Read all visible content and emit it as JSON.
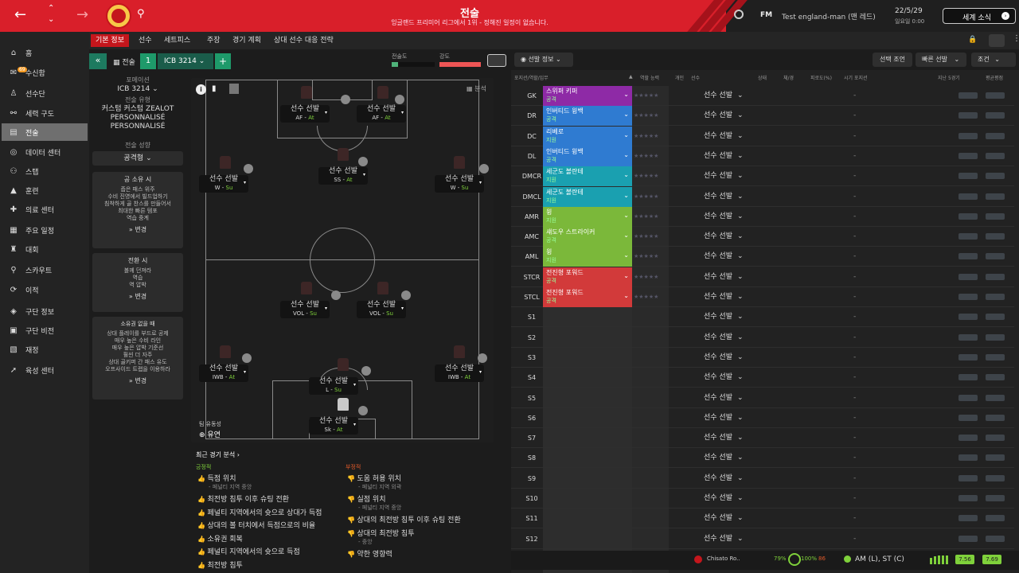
{
  "header": {
    "title": "전술",
    "subtitle": "잉글랜드 프리미어 리그에서 1위 - 정해진 일정이 없습니다.",
    "fm_label": "FM",
    "manager": "Test england-man (맨 레드)",
    "date": "22/5/29",
    "time": "일요일 0:00",
    "news_button": "세계 소식"
  },
  "sidebar": {
    "items": [
      {
        "label": "홈",
        "icon": "home-icon"
      },
      {
        "label": "수신함",
        "icon": "inbox-icon",
        "badge": "69"
      },
      {
        "label": "선수단",
        "icon": "squad-icon"
      },
      {
        "label": "세력 구도",
        "icon": "dynamics-icon"
      },
      {
        "label": "전술",
        "icon": "tactics-icon"
      },
      {
        "label": "데이터 센터",
        "icon": "data-icon"
      },
      {
        "label": "스탭",
        "icon": "staff-icon"
      },
      {
        "label": "훈련",
        "icon": "training-icon"
      },
      {
        "label": "의료 센터",
        "icon": "medical-icon"
      },
      {
        "label": "주요 일정",
        "icon": "calendar-icon"
      },
      {
        "label": "대회",
        "icon": "trophy-icon"
      },
      {
        "label": "스카우트",
        "icon": "scout-icon"
      },
      {
        "label": "이적",
        "icon": "transfer-icon"
      },
      {
        "label": "구단 정보",
        "icon": "club-icon"
      },
      {
        "label": "구단 비전",
        "icon": "vision-icon"
      },
      {
        "label": "재정",
        "icon": "finance-icon"
      },
      {
        "label": "육성 센터",
        "icon": "development-icon"
      }
    ]
  },
  "tabs": [
    "기본 정보",
    "선수",
    "세트피스",
    "주장",
    "경기 계획",
    "상대 선수 대응 전략"
  ],
  "tactic_bar": {
    "label": "전술",
    "slot": "1",
    "name": "ICB 3214",
    "familiarity": "전술도",
    "intensity": "강도"
  },
  "left": {
    "formation_label": "포메이션",
    "formation": "ICB 3214",
    "style_label": "전술 유형",
    "style_lines": [
      "커스텀 커스텀 ZEALOT",
      "PERSONNALISÉ",
      "PERSONNALISÉ"
    ],
    "mentality_label": "전술 성향",
    "mentality": "공격형",
    "in_possession": {
      "title": "공 소유 시",
      "lines": [
        "좁은 패스 위주",
        "수비 진영에서 빌드업하기",
        "침착하게 골 찬스를 만들어서",
        "최대한 빠른 템포",
        "역습 중계"
      ],
      "btn": "변경"
    },
    "transition": {
      "title": "전환 시",
      "lines": [
        "볼께 던져라",
        "역습",
        "역 압박"
      ],
      "btn": "변경"
    },
    "out_possession": {
      "title": "소유권 없을 때",
      "lines": [
        "상대 플레이를 부드로 공제",
        "매우 높은 수비 라인",
        "매우 높은 압박 기준선",
        "훨씬 더 자주",
        "상대 골키퍼 간 패스 유도",
        "오프사이드 트랩을 이용하라"
      ],
      "btn": "변경"
    }
  },
  "pitch": {
    "analysis_label": "분석",
    "fluidity_label": "팀 유동성",
    "fluidity": "유연",
    "slots": [
      {
        "name": "선수 선발",
        "role": "AF",
        "duty": "At"
      },
      {
        "name": "선수 선발",
        "role": "AF",
        "duty": "At"
      },
      {
        "name": "선수 선발",
        "role": "SS",
        "duty": "At"
      },
      {
        "name": "선수 선발",
        "role": "W",
        "duty": "Su"
      },
      {
        "name": "선수 선발",
        "role": "W",
        "duty": "Su"
      },
      {
        "name": "선수 선발",
        "role": "VOL",
        "duty": "Su"
      },
      {
        "name": "선수 선발",
        "role": "VOL",
        "duty": "Su"
      },
      {
        "name": "선수 선발",
        "role": "IWB",
        "duty": "At"
      },
      {
        "name": "선수 선발",
        "role": "IWB",
        "duty": "At"
      },
      {
        "name": "선수 선발",
        "role": "L",
        "duty": "Su"
      },
      {
        "name": "선수 선발",
        "role": "Sk",
        "duty": "At"
      }
    ]
  },
  "analysis": {
    "title": "최근 경기 분석",
    "pos_label": "긍정적",
    "neg_label": "부정적",
    "positives": [
      {
        "t": "득점 위치",
        "s": "- 페널티 지역 중앙"
      },
      {
        "t": "최전방 침투 이후 슈팅 전환"
      },
      {
        "t": "페널티 지역에서의 슛으로 상대가 득점"
      },
      {
        "t": "상대의 볼 터치에서 득점으로의 비율"
      },
      {
        "t": "소유권 회복"
      },
      {
        "t": "페널티 지역에서의 슛으로 득점"
      },
      {
        "t": "최전방 침투"
      }
    ],
    "negatives": [
      {
        "t": "도움 허용 위치",
        "s": "- 페널티 지역 외곽"
      },
      {
        "t": "실점 위치",
        "s": "- 페널티 지역 중앙"
      },
      {
        "t": "상대의 최전방 침투 이후 슈팅 전환"
      },
      {
        "t": "상대의 최전방 침투",
        "s": "- 중앙"
      },
      {
        "t": "약한 영향력"
      }
    ]
  },
  "right": {
    "info_button": "선발 정보",
    "select_button": "선택 조언",
    "quick_button": "빠른 선발",
    "cond_button": "조건",
    "cols": [
      "포지션/역할/임무",
      "역할 능력",
      "개인",
      "선수",
      "상태",
      "체/경",
      "피로도(%)",
      "시기 포지션",
      "지난 5경기",
      "평균평점"
    ],
    "rows": [
      {
        "pos": "GK",
        "role": "스위퍼 키퍼",
        "duty": "공격",
        "color": "#8e2aa6"
      },
      {
        "pos": "DR",
        "role": "인버티드 윙백",
        "duty": "공격",
        "color": "#2f7bd1"
      },
      {
        "pos": "DC",
        "role": "리베로",
        "duty": "지원",
        "color": "#2f7bd1"
      },
      {
        "pos": "DL",
        "role": "인버티드 윙백",
        "duty": "공격",
        "color": "#2f7bd1"
      },
      {
        "pos": "DMCR",
        "role": "세군도 볼란테",
        "duty": "지원",
        "color": "#1aa0b0"
      },
      {
        "pos": "DMCL",
        "role": "세군도 볼란테",
        "duty": "지원",
        "color": "#1aa0b0"
      },
      {
        "pos": "AMR",
        "role": "윙",
        "duty": "지원",
        "color": "#7bb83a"
      },
      {
        "pos": "AMC",
        "role": "섀도우 스트라이커",
        "duty": "공격",
        "color": "#7bb83a"
      },
      {
        "pos": "AML",
        "role": "윙",
        "duty": "지원",
        "color": "#7bb83a"
      },
      {
        "pos": "STCR",
        "role": "전진형 포워드",
        "duty": "공격",
        "color": "#d23a3a"
      },
      {
        "pos": "STCL",
        "role": "전진형 포워드",
        "duty": "공격",
        "color": "#d23a3a"
      },
      {
        "pos": "S1"
      },
      {
        "pos": "S2"
      },
      {
        "pos": "S3"
      },
      {
        "pos": "S4"
      },
      {
        "pos": "S5"
      },
      {
        "pos": "S6"
      },
      {
        "pos": "S7"
      },
      {
        "pos": "S8"
      },
      {
        "pos": "S9"
      },
      {
        "pos": "S10"
      },
      {
        "pos": "S11"
      },
      {
        "pos": "S12"
      }
    ],
    "select_label": "선수 선발",
    "dash": "-"
  },
  "status": {
    "player": "Chisato Ro..",
    "p1": "79%",
    "p2": "100%",
    "p3": "86",
    "position": "AM (L), ST (C)",
    "r1": "7.56",
    "r2": "7.69"
  }
}
